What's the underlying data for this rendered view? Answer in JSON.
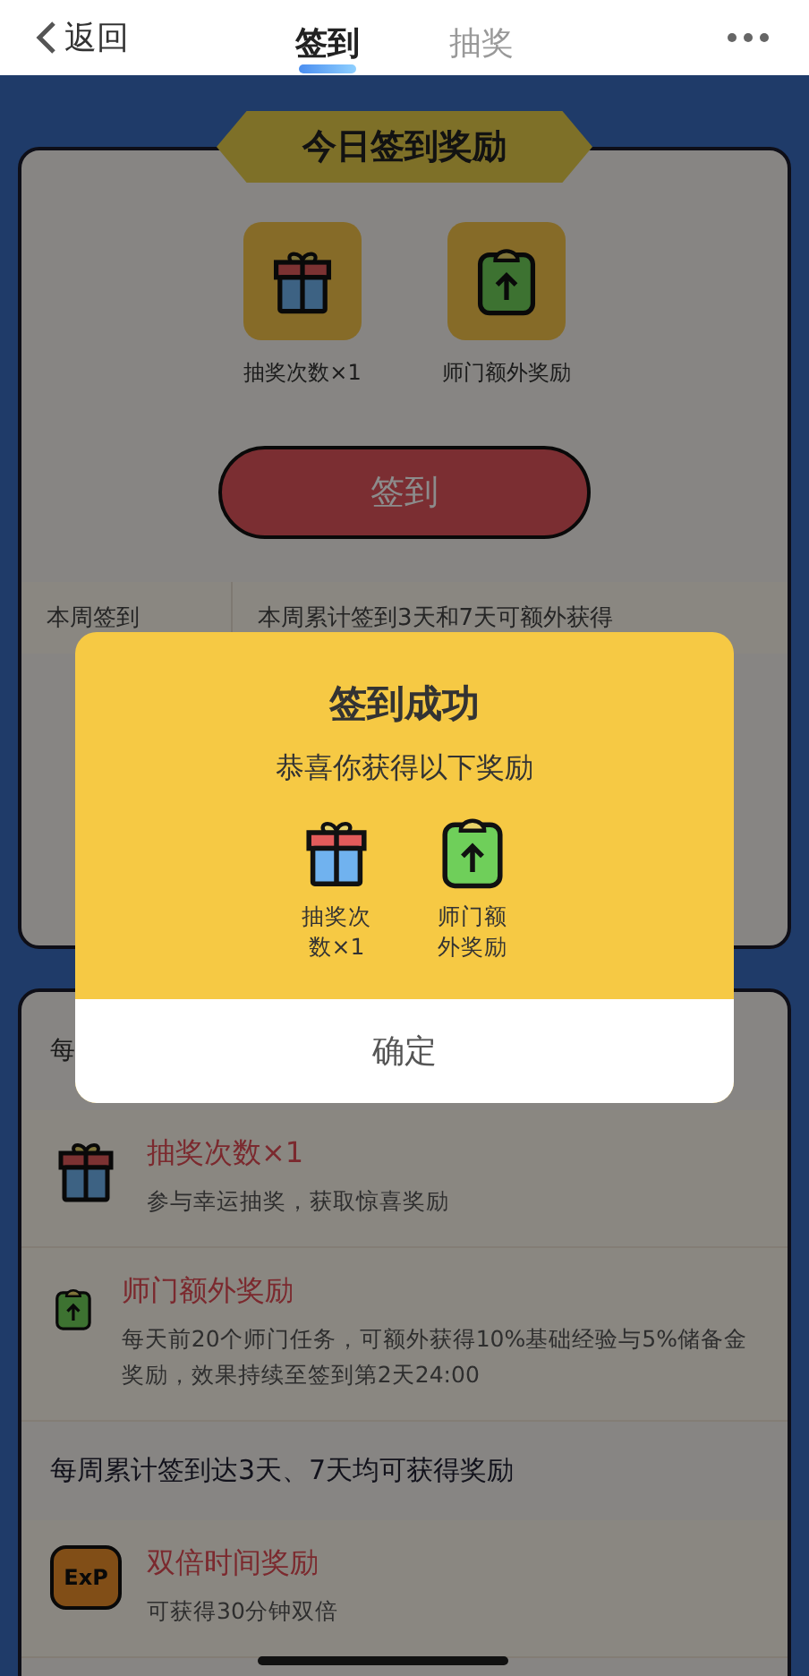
{
  "nav": {
    "back": "返回",
    "tabs": [
      {
        "label": "签到",
        "selected": true
      },
      {
        "label": "抽奖",
        "selected": false
      }
    ]
  },
  "today": {
    "title": "今日签到奖励",
    "rewards": [
      {
        "kind": "gift",
        "label": "抽奖次数×1"
      },
      {
        "kind": "bag",
        "label": "师门额外奖励"
      }
    ],
    "button": "签到",
    "week_row": {
      "label": "本周签到",
      "text": "本周累计签到3天和7天可额外获得"
    }
  },
  "daily": {
    "heading": "每",
    "items": [
      {
        "kind": "gift",
        "title": "抽奖次数×1",
        "desc": "参与幸运抽奖，获取惊喜奖励"
      },
      {
        "kind": "bag",
        "title": "师门额外奖励",
        "desc": "每天前20个师门任务，可额外获得10%基础经验与5%储备金奖励，效果持续至签到第2天24:00"
      }
    ],
    "weekly_heading": "每周累计签到达3天、7天均可获得奖励",
    "weekly_items": [
      {
        "kind": "exp",
        "badge": "ExP",
        "title": "双倍时间奖励",
        "desc": "可获得30分钟双倍"
      }
    ]
  },
  "dialog": {
    "title": "签到成功",
    "subtitle": "恭喜你获得以下奖励",
    "rewards": [
      {
        "kind": "gift",
        "label": "抽奖次数×1"
      },
      {
        "kind": "bag",
        "label": "师门额外奖励"
      }
    ],
    "confirm": "确定"
  }
}
